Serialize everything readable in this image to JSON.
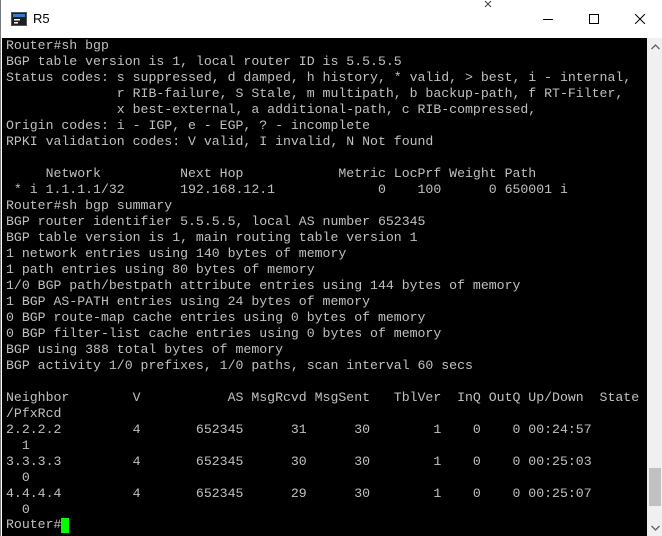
{
  "window": {
    "title": "R5",
    "icons": {
      "app": "terminal-app-icon",
      "minimize": "minimize-icon",
      "maximize": "maximize-icon",
      "close": "close-icon"
    }
  },
  "terminal": {
    "lines": [
      "Router#sh bgp",
      "BGP table version is 1, local router ID is 5.5.5.5",
      "Status codes: s suppressed, d damped, h history, * valid, > best, i - internal,",
      "              r RIB-failure, S Stale, m multipath, b backup-path, f RT-Filter,",
      "              x best-external, a additional-path, c RIB-compressed,",
      "Origin codes: i - IGP, e - EGP, ? - incomplete",
      "RPKI validation codes: V valid, I invalid, N Not found",
      "",
      "     Network          Next Hop            Metric LocPrf Weight Path",
      " * i 1.1.1.1/32       192.168.12.1             0    100      0 650001 i",
      "Router#sh bgp summary",
      "BGP router identifier 5.5.5.5, local AS number 652345",
      "BGP table version is 1, main routing table version 1",
      "1 network entries using 140 bytes of memory",
      "1 path entries using 80 bytes of memory",
      "1/0 BGP path/bestpath attribute entries using 144 bytes of memory",
      "1 BGP AS-PATH entries using 24 bytes of memory",
      "0 BGP route-map cache entries using 0 bytes of memory",
      "0 BGP filter-list cache entries using 0 bytes of memory",
      "BGP using 388 total bytes of memory",
      "BGP activity 1/0 prefixes, 1/0 paths, scan interval 60 secs",
      "",
      "Neighbor        V           AS MsgRcvd MsgSent   TblVer  InQ OutQ Up/Down  State",
      "/PfxRcd",
      "2.2.2.2         4       652345      31      30        1    0    0 00:24:57",
      "  1",
      "3.3.3.3         4       652345      30      30        1    0    0 00:25:03",
      "  0",
      "4.4.4.4         4       652345      29      30        1    0    0 00:25:07",
      "  0"
    ],
    "prompt": "Router#",
    "colors": {
      "background": "#000000",
      "text": "#c0c0c0",
      "cursor": "#00ff00"
    }
  },
  "scrollbar": {
    "icons": {
      "up": "scroll-up-arrow-icon",
      "down": "scroll-down-arrow-icon"
    },
    "position_fraction": 0.97
  }
}
